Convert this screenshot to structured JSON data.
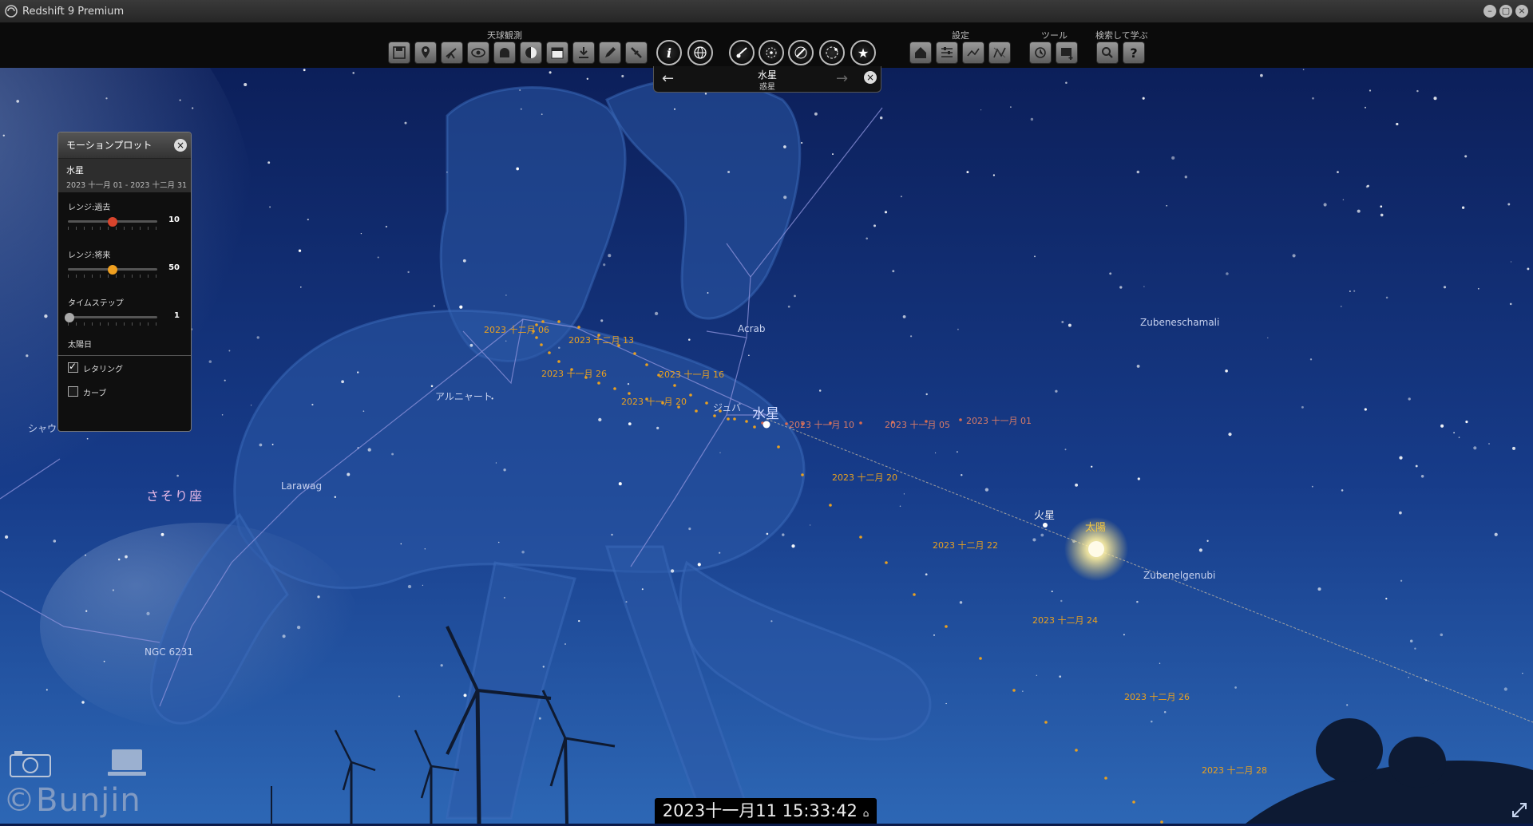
{
  "window": {
    "title": "Redshift 9 Premium"
  },
  "toolbar": {
    "group_observation": "天球観測",
    "group_settings": "設定",
    "group_tools": "ツール",
    "group_search": "検索して学ぶ"
  },
  "selected_object": {
    "name": "水星",
    "type": "惑星"
  },
  "motion_plot": {
    "title": "モーションプロット",
    "object_name": "水星",
    "date_range": "2023 十一月 01 - 2023 十二月 31",
    "range_past": {
      "label": "レンジ:過去",
      "value": "10",
      "fraction": 0.5
    },
    "range_future": {
      "label": "レンジ:将来",
      "value": "50",
      "fraction": 0.5
    },
    "time_step": {
      "label": "タイムステップ",
      "value": "1",
      "fraction": 0.0
    },
    "time_step_unit": "太陽日",
    "lettering": {
      "label": "レタリング",
      "checked": true
    },
    "curve": {
      "label": "カーブ",
      "checked": false
    }
  },
  "sky_labels": {
    "constellation": "さそり座",
    "mercury": "水星",
    "mars": "火星",
    "sun": "太陽",
    "acrab": "Acrab",
    "jabbah": "ジュバ",
    "alniyat": "アルニャート",
    "larawag": "Larawag",
    "ngc": "NGC 6231",
    "zubeneschamali": "Zubeneschamali",
    "zubenelgenubi": "Zubenelgenubi",
    "shaula": "シャウ"
  },
  "motion_dates": [
    "2023 十一月 01",
    "2023 十一月 05",
    "2023 十一月 10",
    "2023 十一月 16",
    "2023 十一月 20",
    "2023 十一月 26",
    "2023 十二月 06",
    "2023 十二月 13",
    "2023 十二月 20",
    "2023 十二月 22",
    "2023 十二月 24",
    "2023 十二月 26",
    "2023 十二月 28"
  ],
  "datetime": "2023十一月11  15:33:42",
  "watermark": "©Bunjin",
  "colors": {
    "sky_top": "#0b1d58",
    "sky_bottom": "#2a62b0",
    "plot_orange": "#e8a020",
    "plot_red": "#d86a50",
    "figure": "#2c5aa6"
  }
}
